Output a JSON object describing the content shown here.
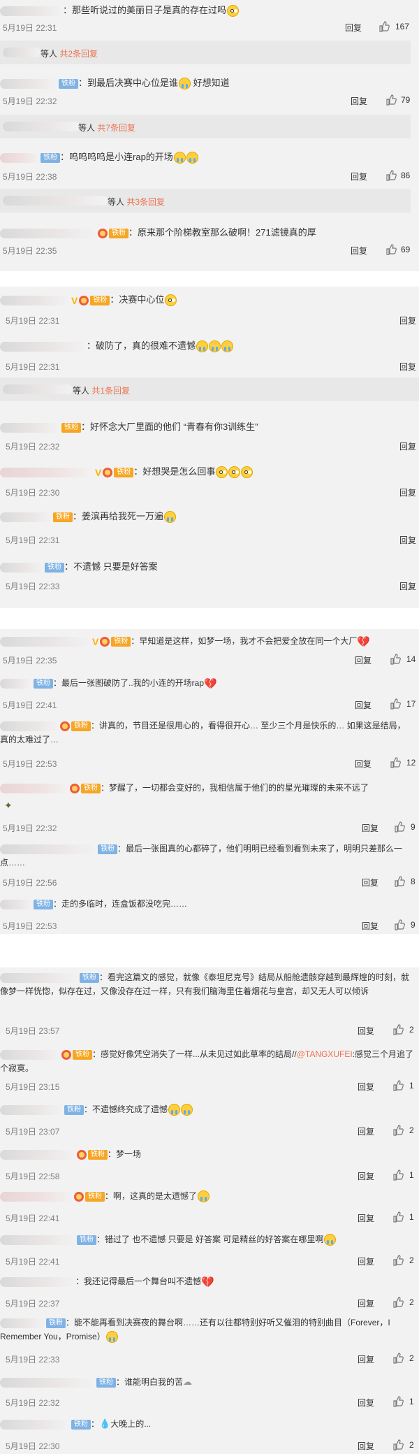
{
  "reply_label": "回复",
  "cards": [
    {
      "comments": [
        {
          "fan": "",
          "text": "那些听说过的美丽日子是真的存在过吗",
          "emojis": [
            "eye"
          ],
          "time": "5月19日 22:31",
          "likes": "167"
        },
        {
          "fan": "铁粉",
          "text": "到最后决赛中心位是谁",
          "emojis": [
            "cry"
          ],
          "after_text": " 好想知道",
          "time": "5月19日 22:32",
          "likes": "79"
        },
        {
          "fan": "铁粉",
          "text": "呜呜呜呜是小连rap的开场",
          "emojis": [
            "cry",
            "cry"
          ],
          "time": "5月19日 22:38",
          "likes": "86"
        },
        {
          "fan": "铁粉",
          "text": "原来那个阶梯教室那么破啊！271滤镜真的厚",
          "emojis": [],
          "time": "5月19日 22:35",
          "likes": "69"
        }
      ],
      "reply_boxes": [
        {
          "who": "等人",
          "total": "共2条回复"
        },
        {
          "who": "等人",
          "total": "共7条回复"
        },
        {
          "who": "等人",
          "total": "共3条回复"
        }
      ]
    },
    {
      "comments": [
        {
          "fan": "铁粉",
          "text": "决赛中心位",
          "emojis": [
            "eye"
          ],
          "time": "5月19日 22:31"
        },
        {
          "fan": "",
          "text": "破防了，真的很难不遗憾",
          "emojis": [
            "cry",
            "cry",
            "cry"
          ],
          "time": "5月19日 22:31"
        },
        {
          "fan": "铁粉",
          "text": "好怀念大厂里面的他们 “青春有你3训练生”",
          "emojis": [],
          "time": "5月19日 22:32"
        },
        {
          "fan": "铁粉",
          "text": "好想哭是怎么回事",
          "emojis": [
            "eye",
            "eye",
            "eye"
          ],
          "time": "5月19日 22:30"
        },
        {
          "fan": "铁粉",
          "text": "姜滨再给我死一万遍",
          "emojis": [
            "cry"
          ],
          "time": "5月19日 22:31"
        },
        {
          "fan": "铁粉",
          "text": "不遗憾 只要是好答案",
          "emojis": [],
          "time": "5月19日 22:33"
        }
      ],
      "reply_boxes": [
        {
          "who": "等人",
          "total": "共1条回复"
        }
      ]
    },
    {
      "comments": [
        {
          "fan": "铁粉",
          "text": "早知道是这样，如梦一场，我才不会把爱全放在同一个大厂",
          "heart": true,
          "time": "5月19日 22:35",
          "likes": "14"
        },
        {
          "fan": "铁粉",
          "text": "最后一张图破防了..我的小连的开场rap",
          "heart": true,
          "time": "5月19日 22:41",
          "likes": "17"
        },
        {
          "fan": "铁粉",
          "text": "讲真的，节目还是很用心的，看得很开心… 至少三个月是快乐的… 如果这是结局，真的太难过了…",
          "time": "5月19日 22:53",
          "likes": "12"
        },
        {
          "fan": "铁粉",
          "text": "梦醒了，一切都会变好的，我相信属于他们的的星光璀璨的未来不远了",
          "time": "5月19日 22:32",
          "likes": "9"
        },
        {
          "fan": "铁粉",
          "text": "最后一张图真的心都碎了，他们明明已经看到看到未来了，明明只差那么一点……",
          "time": "5月19日 22:56",
          "likes": "8"
        },
        {
          "fan": "铁粉",
          "text": "走的多临时，连盒饭都没吃完……",
          "time": "5月19日 22:53",
          "likes": "9"
        }
      ]
    },
    {
      "comments": [
        {
          "fan": "铁粉",
          "text": "看完这篇文的感觉，就像《泰坦尼克号》结局从船舱遗骸穿越到最辉煌的时刻，就像梦一样恍惚，似存在过，又像没存在过一样，只有我们脑海里住着烟花与皇宫，却又无人可以倾诉",
          "time": "5月19日 23:57",
          "likes": "2"
        },
        {
          "fan": "铁粉",
          "text_before": "感觉好像凭空消失了一样...从未见过如此草率的结局//",
          "mention": "@TANGXUFEI",
          "text_after": ":感觉三个月追了个寂寞。",
          "time": "5月19日 23:15",
          "likes": "1"
        },
        {
          "fan": "铁粉",
          "text": "不遗憾终究成了遗憾",
          "emojis": [
            "cry",
            "cry"
          ],
          "time": "5月19日 23:07",
          "likes": "2"
        },
        {
          "fan": "铁粉",
          "text": "梦一场",
          "time": "5月19日 22:58",
          "likes": "1"
        },
        {
          "fan": "铁粉",
          "text": "啊，这真的是太遗憾了",
          "emojis": [
            "cry"
          ],
          "time": "5月19日 22:41",
          "likes": "1"
        },
        {
          "fan": "铁粉",
          "text": "错过了 也不遗憾 只要是 好答案 可是精丝的好答案在哪里啊",
          "emojis": [
            "cry"
          ],
          "time": "5月19日 22:41",
          "likes": "2"
        },
        {
          "fan": "铁粉",
          "text": "我还记得最后一个舞台叫不遗憾",
          "heart": true,
          "time": "5月19日 22:37",
          "likes": "2"
        },
        {
          "fan": "铁粉",
          "text": "能不能再看到决赛夜的舞台啊……还有以往都特别好听又催泪的特别曲目（Forever，I Remember You，Promise）",
          "emojis": [
            "cry"
          ],
          "time": "5月19日 22:33",
          "likes": "2"
        },
        {
          "fan": "铁粉",
          "text": "谁能明白我的苦",
          "time": "5月19日 22:32",
          "likes": "1"
        },
        {
          "fan": "铁粉",
          "text": "大晚上的...",
          "drop": true,
          "time": "5月19日 22:30",
          "likes": "2"
        }
      ]
    }
  ],
  "colors": {
    "background": "#f2f2f2",
    "accent": "#eb7350",
    "fan_badge": "#7fb2e5"
  }
}
